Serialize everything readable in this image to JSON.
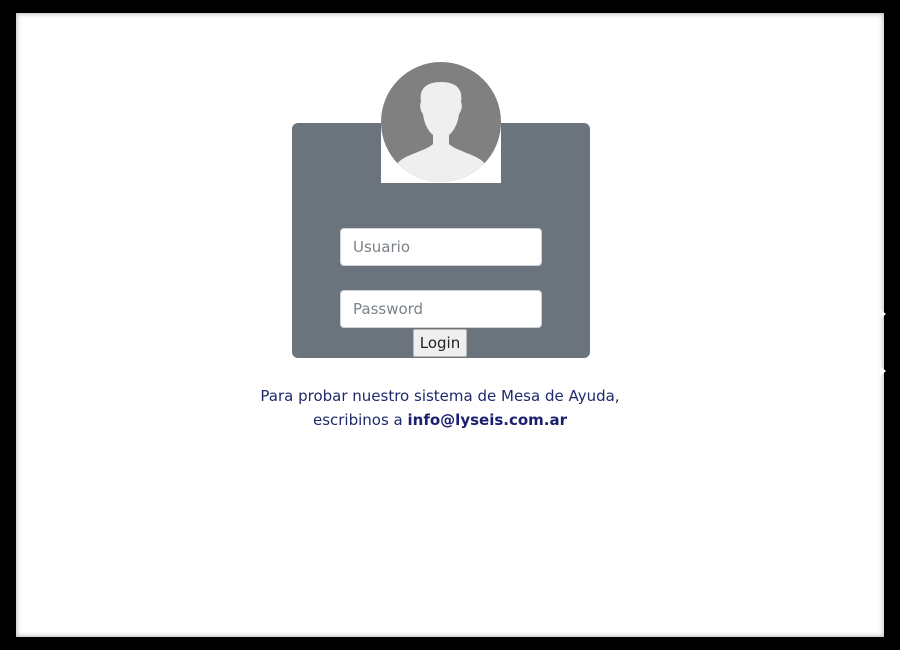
{
  "login_form": {
    "username_placeholder": "Usuario",
    "password_placeholder": "Password",
    "login_label": "Login"
  },
  "help": {
    "line1": "Para probar nuestro sistema de Mesa de Ayuda,",
    "line2_prefix": "escribinos a",
    "email": "info@lyseis.com.ar"
  },
  "icons": {
    "avatar": "user-avatar-icon"
  },
  "colors": {
    "card": "#6b737d",
    "text": "#1f2a6b",
    "avatar_bg": "#808080",
    "avatar_fg": "#efefef"
  }
}
